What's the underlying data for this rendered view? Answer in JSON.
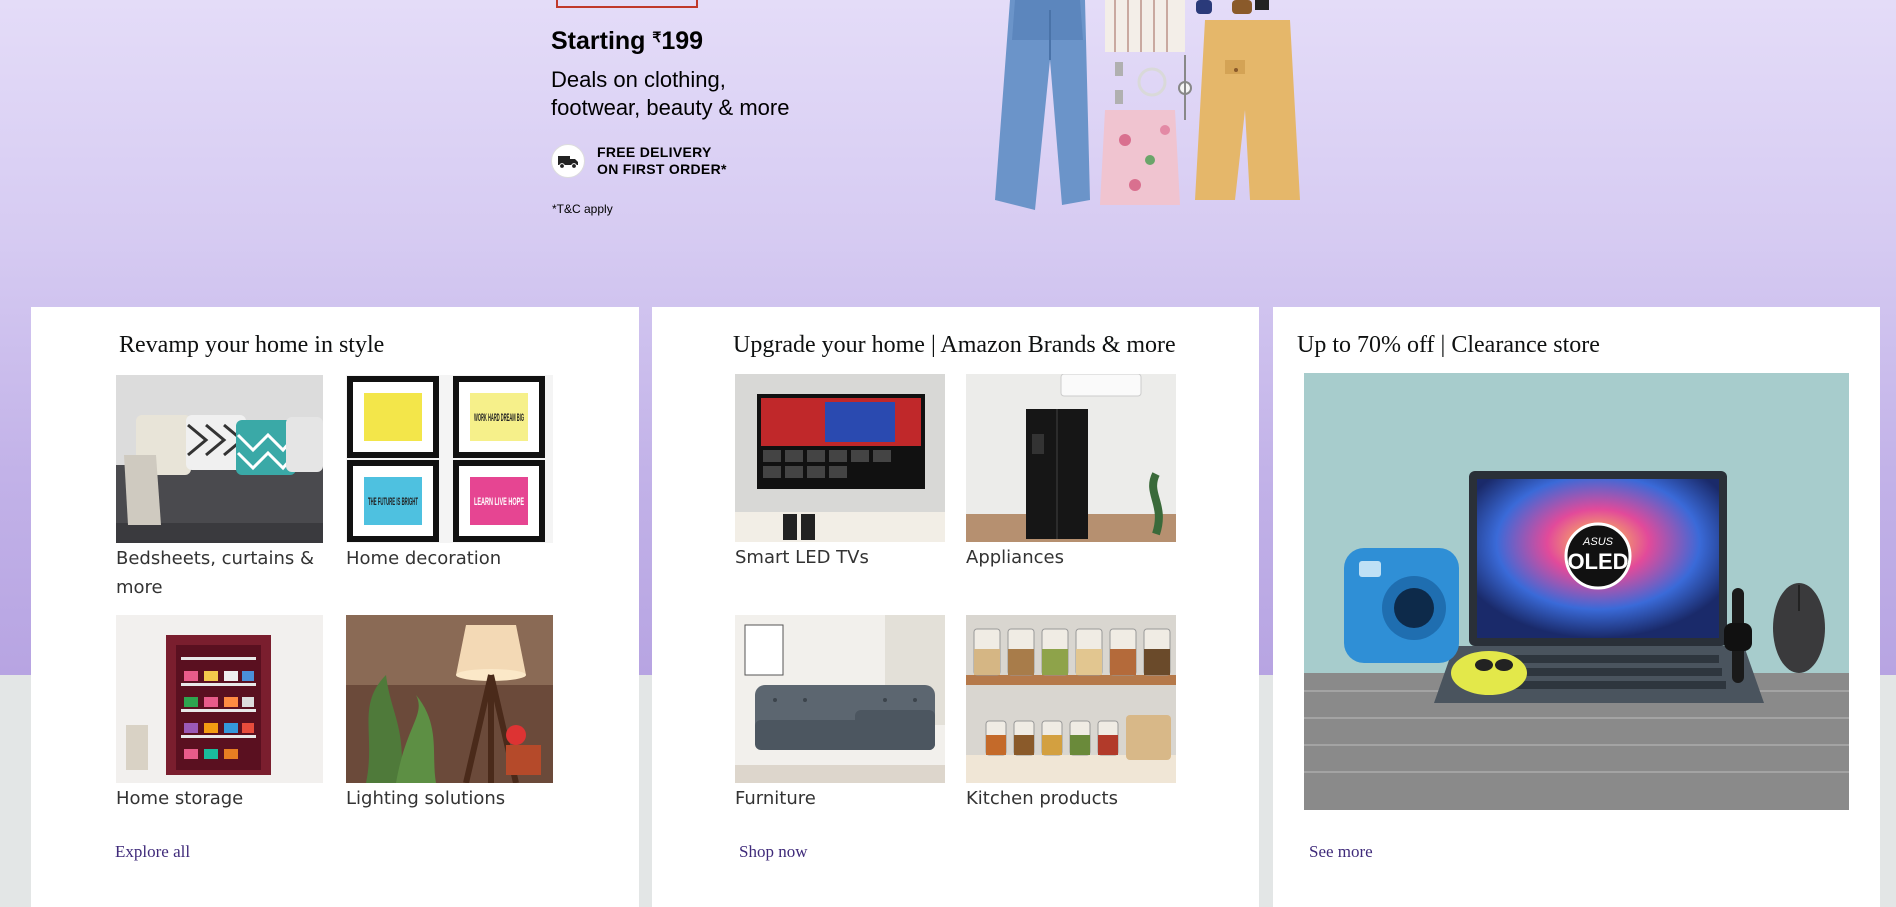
{
  "hero": {
    "starting_label": "Starting",
    "currency_symbol": "₹",
    "starting_price": "199",
    "deals_line1": "Deals on clothing,",
    "deals_line2": "footwear, beauty & more",
    "delivery_line1": "FREE DELIVERY",
    "delivery_line2": "ON FIRST ORDER*",
    "tc": "*T&C apply"
  },
  "cards": [
    {
      "title": "Revamp your home in style",
      "tiles": [
        {
          "label": "Bedsheets, curtains & more"
        },
        {
          "label": "Home decoration"
        },
        {
          "label": "Home storage"
        },
        {
          "label": "Lighting solutions"
        }
      ],
      "link": "Explore all"
    },
    {
      "title": "Upgrade your home | Amazon Brands & more",
      "tiles": [
        {
          "label": "Smart LED TVs"
        },
        {
          "label": "Appliances"
        },
        {
          "label": "Furniture"
        },
        {
          "label": "Kitchen products"
        }
      ],
      "link": "Shop now"
    },
    {
      "title": "Up to 70% off | Clearance store",
      "image_text": "OLED",
      "image_brand": "ASUS",
      "link": "See more"
    }
  ],
  "decor_poster_texts": [
    "WORK HARD DREAM BIG",
    "THE FUTURE IS BRIGHT",
    "LEARN LIVE HOPE"
  ],
  "colors": {
    "hero_top": "#e4dcf8",
    "hero_bottom": "#b7a4e2",
    "page_bg": "#e3e6e6",
    "link": "#3f2a7a",
    "sale_frame": "#c0392b"
  }
}
